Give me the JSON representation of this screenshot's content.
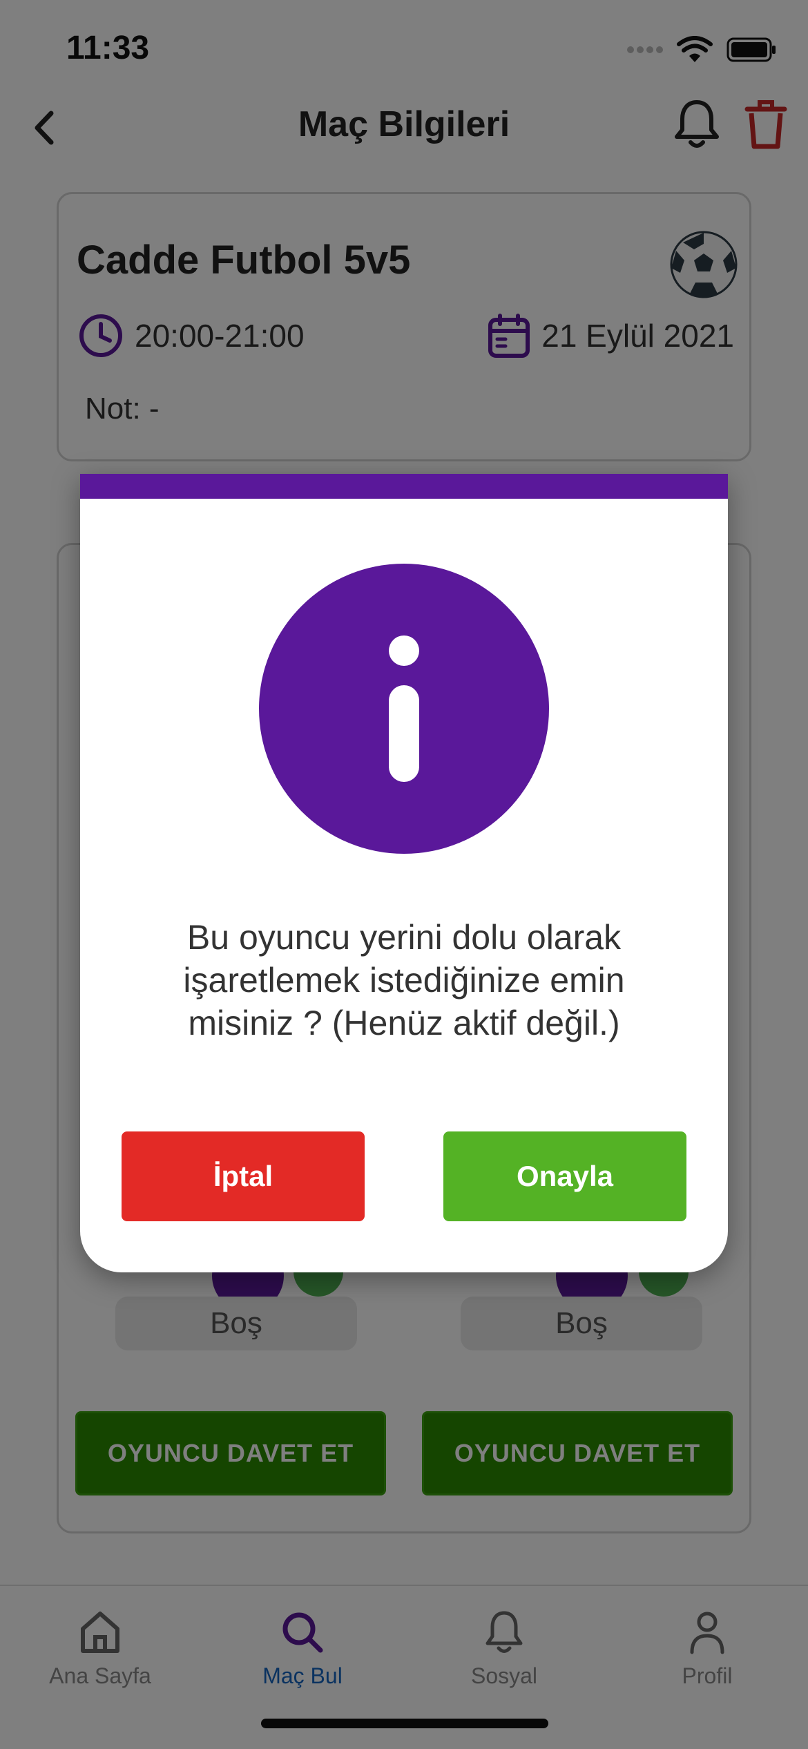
{
  "status_bar": {
    "time": "11:33"
  },
  "header": {
    "title": "Maç Bilgileri"
  },
  "match": {
    "title": "Cadde Futbol 5v5",
    "time": "20:00-21:00",
    "date": "21 Eylül 2021",
    "note": "Not: -"
  },
  "slots": [
    {
      "status": "Boş"
    },
    {
      "status": "Boş"
    }
  ],
  "invite_buttons": [
    {
      "label": "OYUNCU DAVET ET"
    },
    {
      "label": "OYUNCU DAVET ET"
    }
  ],
  "modal": {
    "message": "Bu oyuncu yerini dolu olarak işaretlemek istediğinize emin misiniz ? (Henüz aktif değil.)",
    "cancel_label": "İptal",
    "confirm_label": "Onayla"
  },
  "tabs": [
    {
      "label": "Ana Sayfa",
      "icon": "home-icon",
      "active": false
    },
    {
      "label": "Maç Bul",
      "icon": "search-icon",
      "active": true
    },
    {
      "label": "Sosyal",
      "icon": "bell-icon",
      "active": false
    },
    {
      "label": "Profil",
      "icon": "person-icon",
      "active": false
    }
  ],
  "colors": {
    "primary_purple": "#5a189a",
    "danger_red": "#e32a26",
    "success_green": "#54b225",
    "active_tab_blue": "#1565c0"
  }
}
